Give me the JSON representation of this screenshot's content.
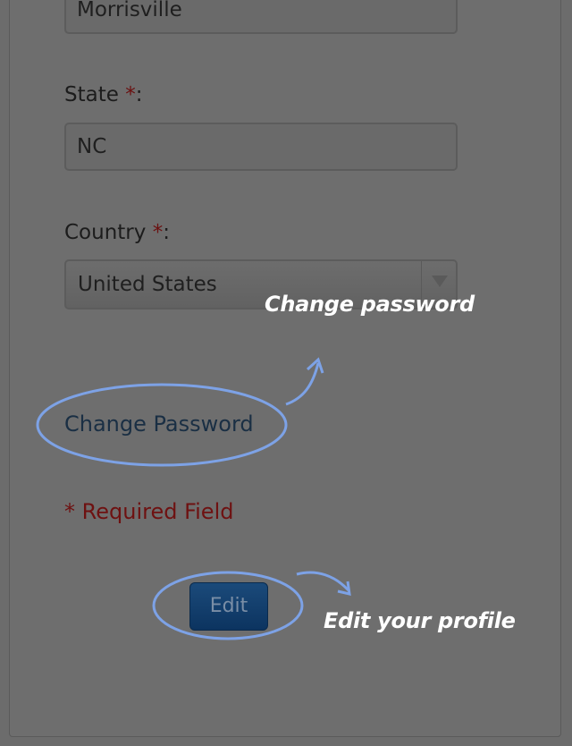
{
  "city": {
    "value": "Morrisville"
  },
  "state": {
    "label": "State",
    "required_mark": "*",
    "colon": ":",
    "value": "NC"
  },
  "country": {
    "label": "Country",
    "required_mark": "*",
    "colon": ":",
    "selected": "United States"
  },
  "change_password": {
    "link_text": "Change Password",
    "callout_text": "Change password"
  },
  "required_note": "* Required Field",
  "edit": {
    "button_label": "Edit",
    "callout_text": "Edit your profile"
  },
  "colors": {
    "overlay_gray": "#6c6c6c",
    "required_red": "#6e1111",
    "link_blue": "#1a2f44",
    "button_blue": "#0c3460",
    "annotation_blue": "#7da2e6"
  },
  "icons": {
    "select_arrow": "chevron-down-icon",
    "callout_arrow": "curved-arrow-icon"
  }
}
